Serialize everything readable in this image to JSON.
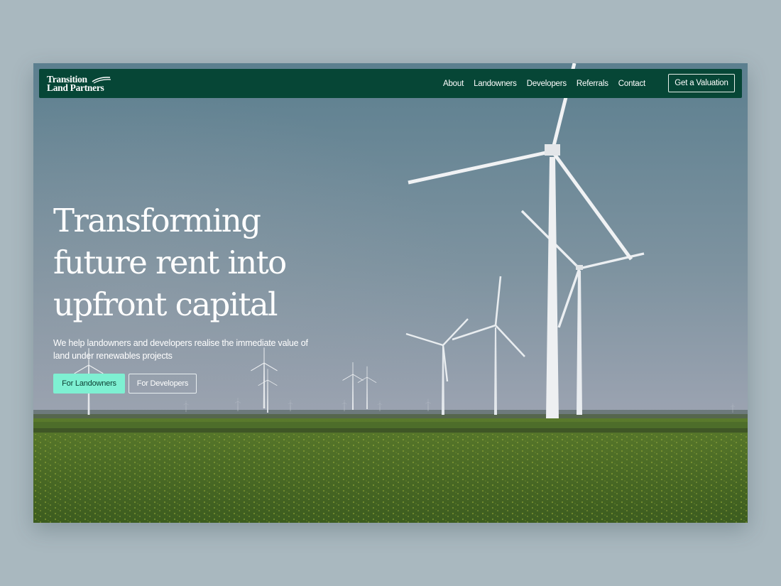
{
  "brand": {
    "name_line1": "Transition",
    "name_line2": "Land Partners"
  },
  "nav": {
    "links": [
      "About",
      "Landowners",
      "Developers",
      "Referrals",
      "Contact"
    ],
    "cta": "Get a Valuation"
  },
  "hero": {
    "title_lines": [
      "Transforming",
      "future rent into",
      "upfront capital"
    ],
    "subtitle": "We help landowners and developers realise the immediate value of land under renewables projects",
    "buttons": {
      "primary": "For Landowners",
      "secondary": "For Developers"
    },
    "background": "wind-farm-photo"
  },
  "colors": {
    "nav_background": "#064636",
    "primary_button": "#7ef0d2",
    "page_background": "#a9b8bf"
  }
}
